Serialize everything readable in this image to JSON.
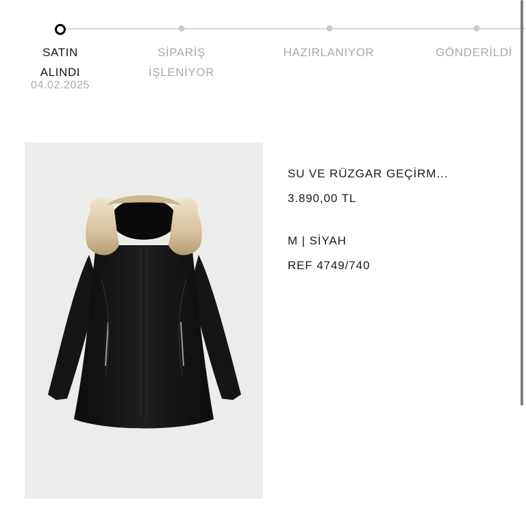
{
  "order_progress": {
    "steps": [
      {
        "label_line1": "SATIN",
        "label_line2": "ALINDI",
        "active": true
      },
      {
        "label_line1": "SİPARİŞ",
        "label_line2": "İŞLENİYOR",
        "active": false
      },
      {
        "label_line1": "HAZIRLANIYOR",
        "label_line2": "",
        "active": false
      },
      {
        "label_line1": "GÖNDERİLDİ",
        "label_line2": "",
        "active": false
      }
    ],
    "date": "04.02.2025"
  },
  "product": {
    "image_icon": "hooded-black-coat-with-fur-trim",
    "name": "SU VE RÜZGAR GEÇİRM...",
    "price": "3.890,00 TL",
    "variant": "M | SİYAH",
    "ref": "REF 4749/740"
  },
  "colors": {
    "active_step": "#000000",
    "inactive_step": "#a9a9a9",
    "track": "#d6d6d6",
    "image_bg": "#ececea"
  }
}
